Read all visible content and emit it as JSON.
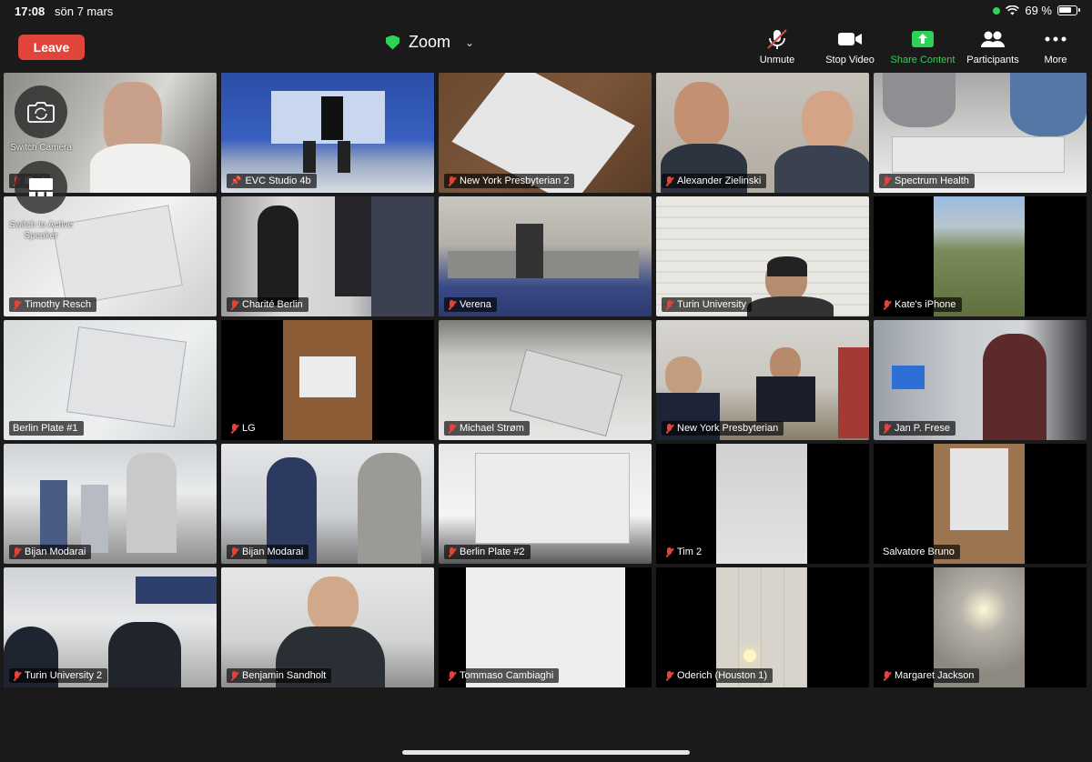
{
  "status_bar": {
    "time": "17:08",
    "date": "sön 7 mars",
    "battery": "69 %"
  },
  "toolbar": {
    "leave_label": "Leave",
    "title": "Zoom",
    "unmute_label": "Unmute",
    "stop_video_label": "Stop Video",
    "share_label": "Share Content",
    "participants_label": "Participants",
    "more_label": "More",
    "share_color": "#2fd158",
    "leave_color": "#e0443b"
  },
  "floating": {
    "switch_camera_label": "Switch Camera",
    "active_speaker_label": "Switch to Active Speaker"
  },
  "tiles": [
    {
      "name": "iPad",
      "muted": true
    },
    {
      "name": "EVC Studio 4b",
      "muted": false,
      "active": true
    },
    {
      "name": "New York Presbyterian 2",
      "muted": true
    },
    {
      "name": "Alexander Zielinski",
      "muted": true
    },
    {
      "name": "Spectrum Health",
      "muted": true
    },
    {
      "name": "Timothy Resch",
      "muted": true
    },
    {
      "name": "Charité Berlin",
      "muted": true
    },
    {
      "name": "Verena",
      "muted": true
    },
    {
      "name": "Turin University",
      "muted": true
    },
    {
      "name": "Kate's iPhone",
      "muted": true
    },
    {
      "name": "Berlin Plate #1",
      "muted": false
    },
    {
      "name": "LG",
      "muted": true
    },
    {
      "name": "Michael Strøm",
      "muted": true
    },
    {
      "name": "New York Presbyterian",
      "muted": true
    },
    {
      "name": "Jan P. Frese",
      "muted": true
    },
    {
      "name": "Bijan Modarai",
      "muted": true
    },
    {
      "name": "Bijan Modarai",
      "muted": true
    },
    {
      "name": "Berlin Plate #2",
      "muted": true
    },
    {
      "name": "Tim 2",
      "muted": true
    },
    {
      "name": "Salvatore Bruno",
      "muted": false
    },
    {
      "name": "Turin University 2",
      "muted": true
    },
    {
      "name": "Benjamin Sandholt",
      "muted": true
    },
    {
      "name": "Tommaso Cambiaghi",
      "muted": true
    },
    {
      "name": "Oderich (Houston 1)",
      "muted": true
    },
    {
      "name": "Margaret Jackson",
      "muted": true
    }
  ]
}
